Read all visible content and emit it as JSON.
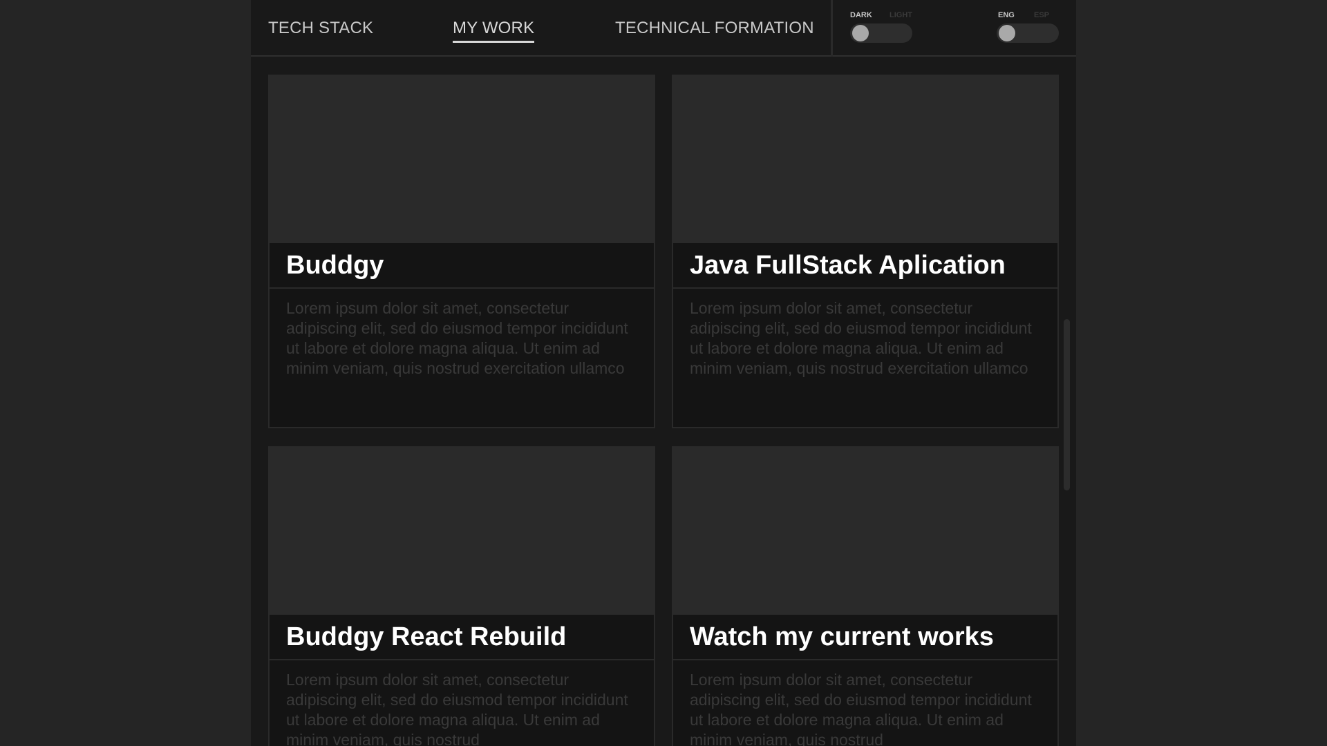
{
  "nav": {
    "tabs": [
      {
        "label": "TECH STACK",
        "active": false
      },
      {
        "label": "MY WORK",
        "active": true
      },
      {
        "label": "TECHNICAL FORMATION",
        "active": false
      }
    ]
  },
  "toggles": {
    "theme": {
      "left_label": "DARK",
      "right_label": "LIGHT",
      "selected": "DARK"
    },
    "language": {
      "left_label": "ENG",
      "right_label": "ESP",
      "selected": "ENG"
    }
  },
  "projects": [
    {
      "title": "Buddgy",
      "description": "Lorem ipsum dolor sit amet, consectetur adipiscing elit, sed do eiusmod tempor incididunt ut labore et dolore magna aliqua. Ut enim ad minim veniam, quis nostrud exercitation ullamco"
    },
    {
      "title": "Java FullStack Aplication",
      "description": "Lorem ipsum dolor sit amet, consectetur adipiscing elit, sed do eiusmod tempor incididunt ut labore et dolore magna aliqua. Ut enim ad minim veniam, quis nostrud exercitation ullamco"
    },
    {
      "title": "Buddgy React Rebuild",
      "description": "Lorem ipsum dolor sit amet, consectetur adipiscing elit, sed do eiusmod tempor incididunt ut labore et dolore magna aliqua. Ut enim ad minim veniam, quis nostrud"
    },
    {
      "title": "Watch my current works",
      "description": "Lorem ipsum dolor sit amet, consectetur adipiscing elit, sed do eiusmod tempor incididunt ut labore et dolore magna aliqua. Ut enim ad minim veniam, quis nostrud"
    }
  ],
  "colors": {
    "page_background": "#252525",
    "app_background": "#191919",
    "card_image": "#2a2a2a",
    "card_panel": "#141414",
    "title_text": "#ffffff",
    "description_text": "#393939"
  }
}
